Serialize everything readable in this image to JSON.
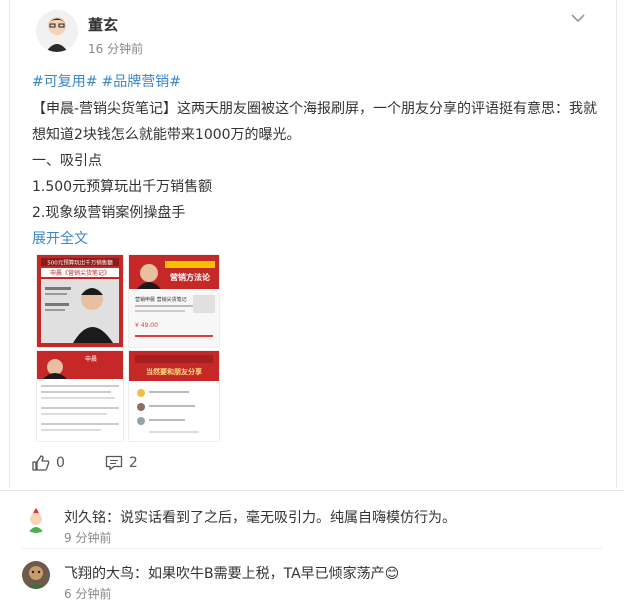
{
  "post": {
    "username": "董玄",
    "time": "16 分钟前",
    "tags": [
      "#可复用#",
      "#品牌营销#"
    ],
    "body_lines": [
      "【申晨-营销尖货笔记】这两天朋友圈被这个海报刷屏，一个朋友分享的评语挺有意思：我就",
      "想知道2块钱怎么就能带来1000万的曝光。",
      "一、吸引点",
      "1.500元预算玩出千万销售额",
      "2.现象级营销案例操盘手"
    ],
    "expand_label": "展开全文",
    "images": [
      {
        "name": "poster-1",
        "headline": "500元预算玩出千万销售额",
        "banner": "申晨《营销尖货笔记》"
      },
      {
        "name": "poster-2",
        "headline": "营销方法论",
        "title": "营销申晨 营销尖货笔记",
        "price": "¥ 49.00"
      },
      {
        "name": "poster-3",
        "author": "申晨"
      },
      {
        "name": "poster-4",
        "headline": "当然要和朋友分享"
      }
    ],
    "like_count": "0",
    "comment_count": "2"
  },
  "comments": [
    {
      "name": "刘久铭",
      "separator": "：",
      "text": "说实话看到了之后，毫无吸引力。纯属自嗨模仿行为。",
      "time": "9 分钟前"
    },
    {
      "name": "飞翔的大鸟",
      "separator": "：",
      "text": "如果吹牛B需要上税，TA早已倾家荡产",
      "emoji": "😊",
      "time": "6 分钟前"
    }
  ],
  "colors": {
    "link": "#3a86c8",
    "poster_red": "#c62828",
    "muted": "#888888"
  }
}
